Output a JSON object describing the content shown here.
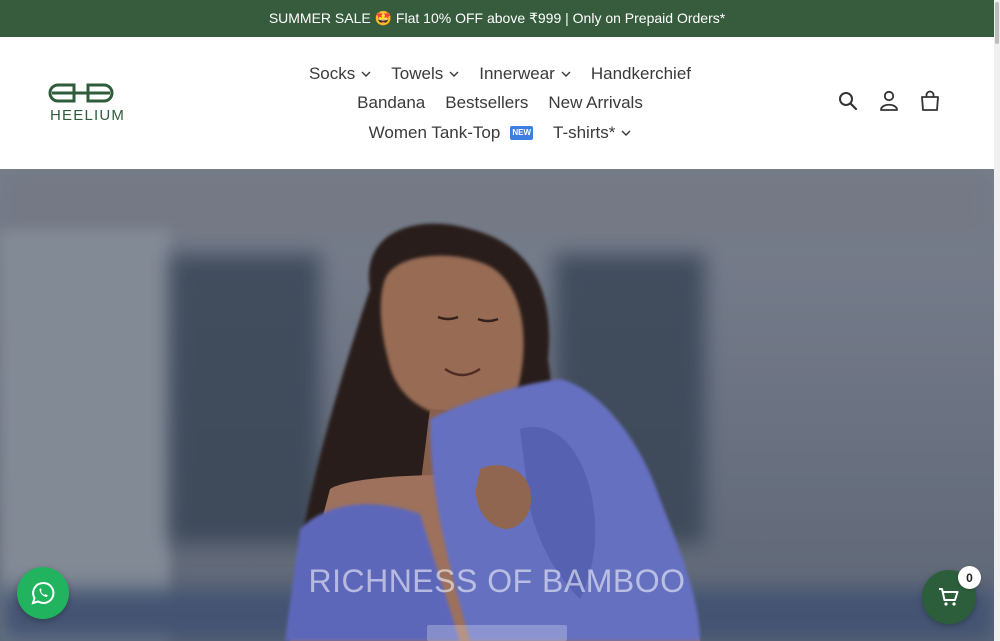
{
  "announcement": {
    "text": "SUMMER SALE 🤩 Flat 10% OFF above ₹999 | Only on Prepaid Orders*"
  },
  "brand": {
    "name": "HEELIUM",
    "color": "#2f5d3b"
  },
  "nav": {
    "row1": [
      {
        "label": "Socks",
        "dropdown": true
      },
      {
        "label": "Towels",
        "dropdown": true
      },
      {
        "label": "Innerwear",
        "dropdown": true
      },
      {
        "label": "Handkerchief",
        "dropdown": false
      }
    ],
    "row2": [
      {
        "label": "Bandana"
      },
      {
        "label": "Bestsellers"
      },
      {
        "label": "New Arrivals"
      }
    ],
    "row3": [
      {
        "label": "Women Tank-Top",
        "badge": "NEW"
      },
      {
        "label": "T-shirts*",
        "dropdown": true
      }
    ]
  },
  "icons": {
    "search": "search-icon",
    "account": "account-icon",
    "cart": "shopping-bag-icon",
    "whatsapp": "whatsapp-icon",
    "floating_cart": "cart-icon"
  },
  "hero": {
    "title": "RICHNESS OF BAMBOO"
  },
  "cart": {
    "count": "0"
  },
  "colors": {
    "announcement_bg": "#365c3d",
    "whatsapp": "#22b35e",
    "cart_fab": "#2d5e3c"
  }
}
